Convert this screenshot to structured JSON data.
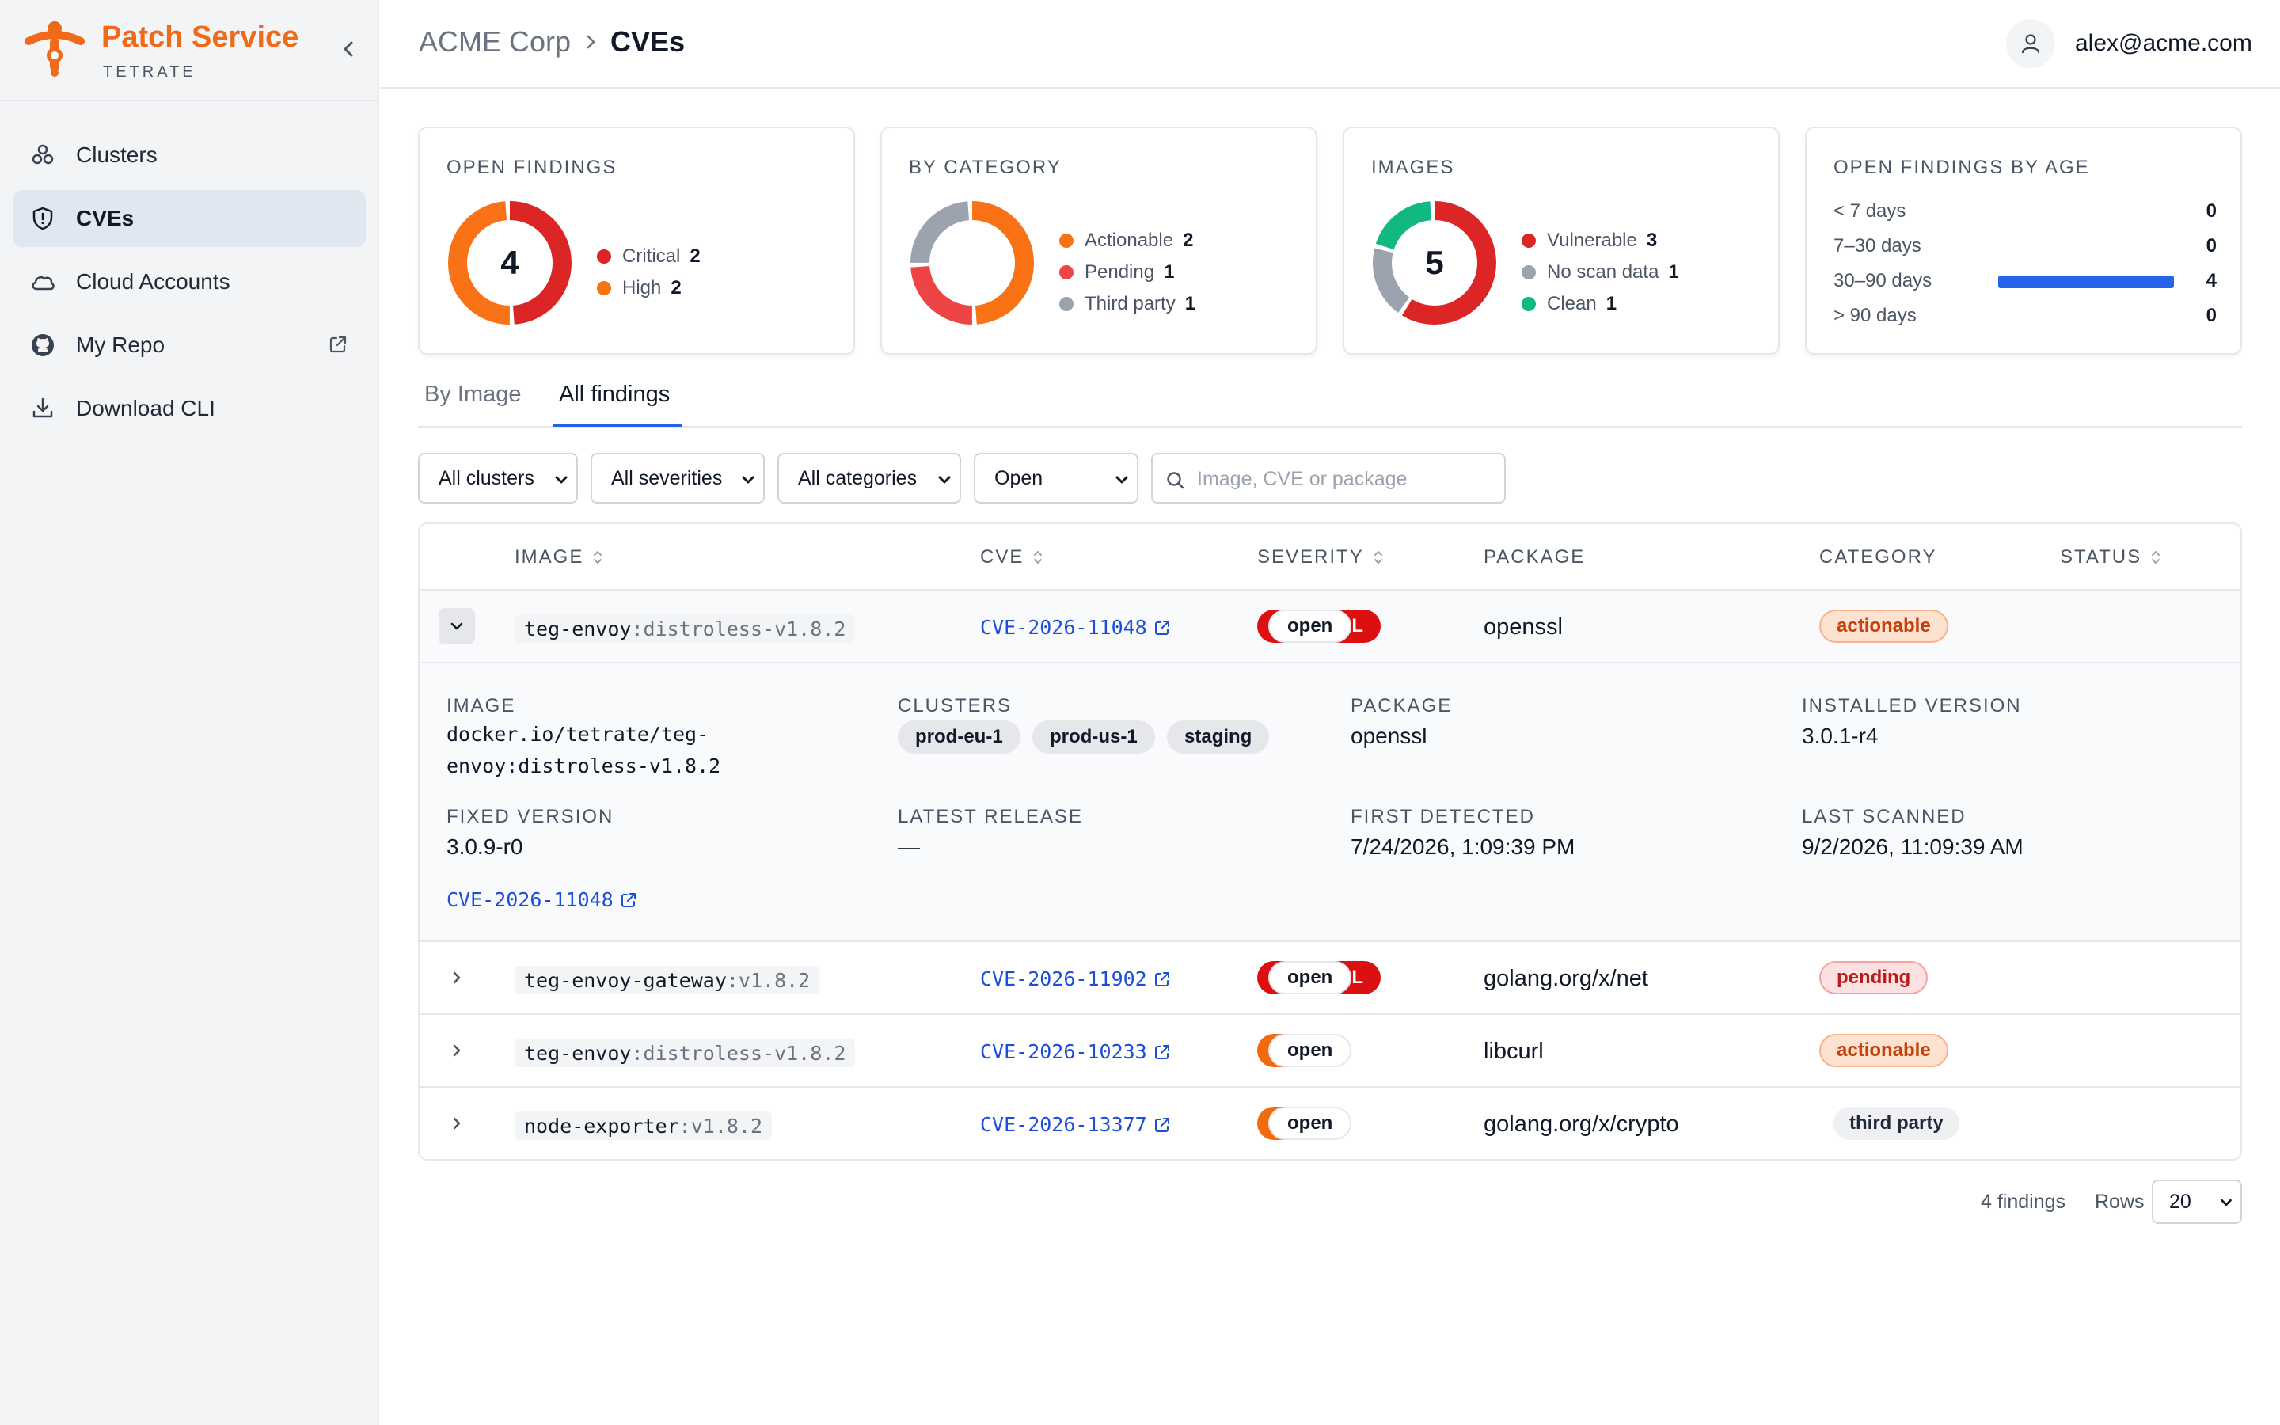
{
  "brand": {
    "name": "Patch Service",
    "subtitle": "TETRATE",
    "color": "#f06a1a"
  },
  "sidebar": {
    "items": [
      {
        "label": "Clusters",
        "icon": "clusters-icon",
        "active": false
      },
      {
        "label": "CVEs",
        "icon": "shield-icon",
        "active": true
      },
      {
        "label": "Cloud Accounts",
        "icon": "cloud-icon",
        "active": false
      },
      {
        "label": "My Repo",
        "icon": "github-icon",
        "active": false,
        "external": true
      },
      {
        "label": "Download CLI",
        "icon": "download-icon",
        "active": false
      }
    ]
  },
  "header": {
    "breadcrumb": [
      "ACME Corp",
      "CVEs"
    ],
    "user_email": "alex@acme.com"
  },
  "cards": {
    "open_findings": {
      "title": "OPEN FINDINGS",
      "total": "4",
      "legend": [
        {
          "label": "Critical",
          "value": "2",
          "color": "#dc2626"
        },
        {
          "label": "High",
          "value": "2",
          "color": "#f97316"
        }
      ]
    },
    "by_category": {
      "title": "BY CATEGORY",
      "legend": [
        {
          "label": "Actionable",
          "value": "2",
          "color": "#f97316"
        },
        {
          "label": "Pending",
          "value": "1",
          "color": "#ef4444"
        },
        {
          "label": "Third party",
          "value": "1",
          "color": "#9ca3af"
        }
      ]
    },
    "images": {
      "title": "IMAGES",
      "total": "5",
      "legend": [
        {
          "label": "Vulnerable",
          "value": "3",
          "color": "#dc2626"
        },
        {
          "label": "No scan data",
          "value": "1",
          "color": "#9ca3af"
        },
        {
          "label": "Clean",
          "value": "1",
          "color": "#10b981"
        }
      ]
    },
    "age": {
      "title": "OPEN FINDINGS BY AGE",
      "rows": [
        {
          "label": "< 7 days",
          "value": "0",
          "fraction": 0
        },
        {
          "label": "7–30 days",
          "value": "0",
          "fraction": 0
        },
        {
          "label": "30–90 days",
          "value": "4",
          "fraction": 1
        },
        {
          "label": "> 90 days",
          "value": "0",
          "fraction": 0
        }
      ]
    }
  },
  "tabs": [
    {
      "label": "By Image",
      "active": false
    },
    {
      "label": "All findings",
      "active": true
    }
  ],
  "filters": {
    "clusters": "All clusters",
    "severities": "All severities",
    "categories": "All categories",
    "status": "Open",
    "search_placeholder": "Image, CVE or package"
  },
  "table": {
    "columns": {
      "image": "IMAGE",
      "cve": "CVE",
      "severity": "SEVERITY",
      "package": "PACKAGE",
      "category": "CATEGORY",
      "status": "STATUS"
    },
    "rows": [
      {
        "image": "teg-envoy",
        "tag": ":distroless-v1.8.2",
        "cve": "CVE-2026-11048",
        "severity": "CRITICAL",
        "package": "openssl",
        "category": "actionable",
        "status": "open",
        "expanded": true
      },
      {
        "image": "teg-envoy-gateway",
        "tag": ":v1.8.2",
        "cve": "CVE-2026-11902",
        "severity": "CRITICAL",
        "package": "golang.org/x/net",
        "category": "pending",
        "status": "open",
        "expanded": false
      },
      {
        "image": "teg-envoy",
        "tag": ":distroless-v1.8.2",
        "cve": "CVE-2026-10233",
        "severity": "HIGH",
        "package": "libcurl",
        "category": "actionable",
        "status": "open",
        "expanded": false
      },
      {
        "image": "node-exporter",
        "tag": ":v1.8.2",
        "cve": "CVE-2026-13377",
        "severity": "HIGH",
        "package": "golang.org/x/crypto",
        "category": "third party",
        "status": "open",
        "expanded": false
      }
    ],
    "details": {
      "image_label": "IMAGE",
      "image": "docker.io/tetrate/teg-envoy:distroless-v1.8.2",
      "clusters_label": "CLUSTERS",
      "clusters": [
        "prod-eu-1",
        "prod-us-1",
        "staging"
      ],
      "package_label": "PACKAGE",
      "package": "openssl",
      "installed_label": "INSTALLED VERSION",
      "installed": "3.0.1-r4",
      "fixed_label": "FIXED VERSION",
      "fixed": "3.0.9-r0",
      "latest_label": "LATEST RELEASE",
      "latest": "—",
      "first_label": "FIRST DETECTED",
      "first": "7/24/2026, 1:09:39 PM",
      "last_label": "LAST SCANNED",
      "last": "9/2/2026, 11:09:39 AM",
      "cve_link": "CVE-2026-11048"
    }
  },
  "footer": {
    "count": "4 findings",
    "rows_label": "Rows",
    "rows_value": "20"
  },
  "colors": {
    "accent": "#2563eb",
    "critical": "#dc1010",
    "high": "#f06a10",
    "link": "#1d4ed8"
  }
}
